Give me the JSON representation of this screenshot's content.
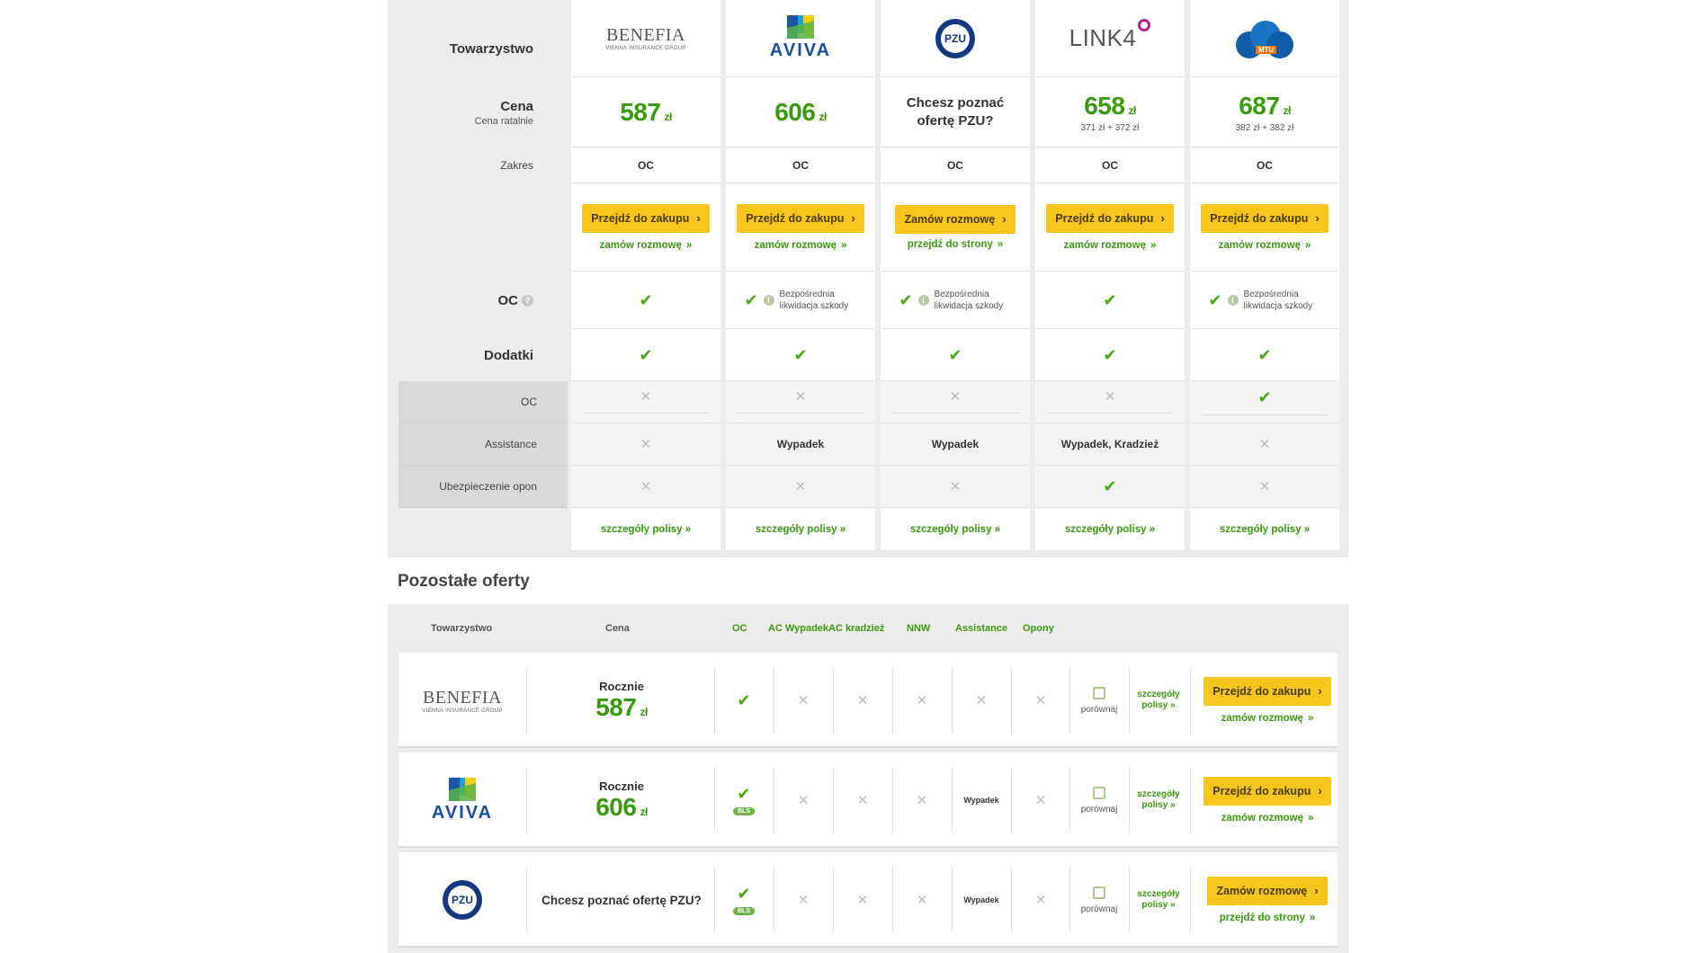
{
  "compare": {
    "labels": {
      "company": "Towarzystwo",
      "price": "Cena",
      "price_sub": "Cena ratalnie",
      "scope": "Zakres",
      "oc": "OC",
      "extras": "Dodatki",
      "sub_oc": "OC",
      "sub_assistance": "Assistance",
      "sub_tires": "Ubezpieczenie opon"
    },
    "benefia": {
      "logo_text": "BENEFIA",
      "logo_sub": "VIENNA INSURANCE GROUP",
      "price": "587",
      "currency": "zł",
      "scope": "OC",
      "button": "Przejdź do zakupu",
      "link": "zamów rozmowę",
      "assistance": "",
      "details": "szczegóły polisy"
    },
    "aviva": {
      "logo_text": "AVIVA",
      "price": "606",
      "currency": "zł",
      "scope": "OC",
      "button": "Przejdź do zakupu",
      "link": "zamów rozmowę",
      "bl_text": "Bezpośrednia likwidacja szkody",
      "assistance": "Wypadek",
      "details": "szczegóły polisy"
    },
    "pzu": {
      "logo_text": "PZU",
      "ask": "Chcesz poznać ofertę PZU?",
      "scope": "OC",
      "button": "Zamów rozmowę",
      "link": "przejdź do strony",
      "bl_text": "Bezpośrednia likwidacja szkody",
      "assistance": "Wypadek",
      "details": "szczegóły polisy"
    },
    "link4": {
      "logo_text": "LINK4",
      "price": "658",
      "currency": "zł",
      "installments": "371 zł + 372 zł",
      "scope": "OC",
      "button": "Przejdź do zakupu",
      "link": "zamów rozmowę",
      "assistance": "Wypadek, Kradzież",
      "details": "szczegóły polisy"
    },
    "mtu": {
      "logo_text": "MTU",
      "price": "687",
      "currency": "zł",
      "installments": "382 zł + 382 zł",
      "scope": "OC",
      "button": "Przejdź do zakupu",
      "link": "zamów rozmowę",
      "bl_text": "Bezpośrednia likwidacja szkody",
      "details": "szczegóły polisy"
    }
  },
  "others": {
    "title": "Pozostałe oferty",
    "headers": {
      "company": "Towarzystwo",
      "price": "Cena",
      "oc": "OC",
      "ac_accident": "AC Wypadek",
      "ac_theft": "AC kradzież",
      "nnw": "NNW",
      "assistance": "Assistance",
      "tires": "Opony"
    },
    "rows": [
      {
        "logo_text": "BENEFIA",
        "logo_sub": "VIENNA INSURANCE GROUP",
        "period": "Rocznie",
        "price": "587",
        "currency": "zł",
        "compare": "porównaj",
        "details_line1": "szczegóły",
        "details_line2": "polisy",
        "button": "Przejdź do zakupu",
        "link": "zamów rozmowę"
      },
      {
        "logo_text": "AVIVA",
        "period": "Rocznie",
        "price": "606",
        "currency": "zł",
        "badge": "BLS",
        "assistance": "Wypadek",
        "compare": "porównaj",
        "details_line1": "szczegóły",
        "details_line2": "polisy",
        "button": "Przejdź do zakupu",
        "link": "zamów rozmowę"
      },
      {
        "logo_text": "PZU",
        "ask": "Chcesz poznać ofertę PZU?",
        "badge": "BLS",
        "assistance": "Wypadek",
        "compare": "porównaj",
        "details_line1": "szczegóły",
        "details_line2": "polisy",
        "button": "Zamów rozmowę",
        "link": "przejdź do strony"
      }
    ]
  },
  "icons": {
    "check": "✔",
    "cross": "✕",
    "chevron": "›",
    "raquo": "»",
    "info": "i",
    "question": "?"
  },
  "colors": {
    "accent_green": "#3a9a0e",
    "button_yellow": "#f7c51b",
    "panel_grey": "#ececec"
  }
}
